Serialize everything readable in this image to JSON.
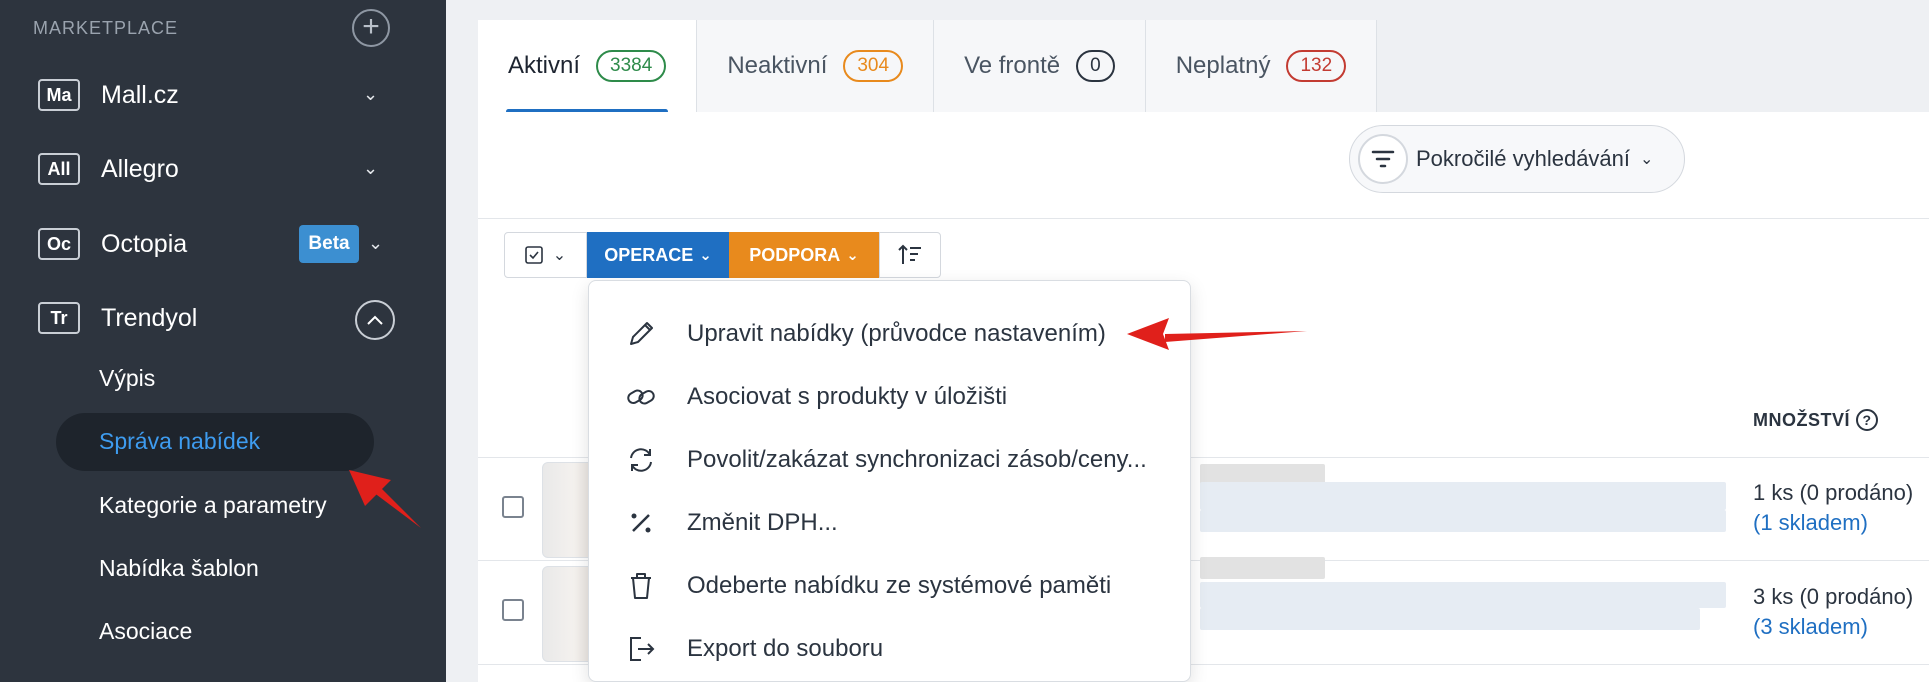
{
  "sidebar": {
    "section_title": "MARKETPLACE",
    "add_symbol": "+",
    "marketplaces": [
      {
        "badge": "Ma",
        "label": "Mall.cz"
      },
      {
        "badge": "All",
        "label": "Allegro"
      },
      {
        "badge": "Oc",
        "label": "Octopia",
        "tag": "Beta"
      },
      {
        "badge": "Tr",
        "label": "Trendyol"
      }
    ],
    "sub_items": [
      "Výpis",
      "Správa nabídek",
      "Kategorie a parametry",
      "Nabídka šablon",
      "Asociace"
    ],
    "active_sub": "Správa nabídek"
  },
  "tabs": [
    {
      "label": "Aktivní",
      "count": "3384",
      "color": "#2e8b4a"
    },
    {
      "label": "Neaktivní",
      "count": "304",
      "color": "#e88a1d"
    },
    {
      "label": "Ve frontě",
      "count": "0",
      "color": "#2b3440"
    },
    {
      "label": "Neplatný",
      "count": "132",
      "color": "#c33b32"
    }
  ],
  "search": {
    "advanced_label": "Pokročilé vyhledávání"
  },
  "toolbar": {
    "operations_label": "OPERACE",
    "support_label": "PODPORA"
  },
  "operations_menu": [
    {
      "icon": "pencil-icon",
      "label": "Upravit nabídky (průvodce nastavením)"
    },
    {
      "icon": "link-icon",
      "label": "Asociovat s produkty v úložišti"
    },
    {
      "icon": "sync-icon",
      "label": "Povolit/zakázat synchronizaci zásob/ceny..."
    },
    {
      "icon": "percent-icon",
      "label": "Změnit DPH..."
    },
    {
      "icon": "trash-icon",
      "label": "Odeberte nabídku ze systémové paměti"
    },
    {
      "icon": "export-icon",
      "label": "Export do souboru"
    }
  ],
  "table": {
    "qty_header": "MNOŽSTVÍ",
    "rows": [
      {
        "qty": "1 ks (0 prodáno)",
        "stock": "(1 skladem)"
      },
      {
        "qty": "3 ks (0 prodáno)",
        "stock": "(3 skladem)"
      }
    ]
  },
  "colors": {
    "sidebar_bg": "#2d343e",
    "primary": "#1f6fc2",
    "accent_orange": "#e88a1d",
    "annotation_red": "#e0201b"
  }
}
